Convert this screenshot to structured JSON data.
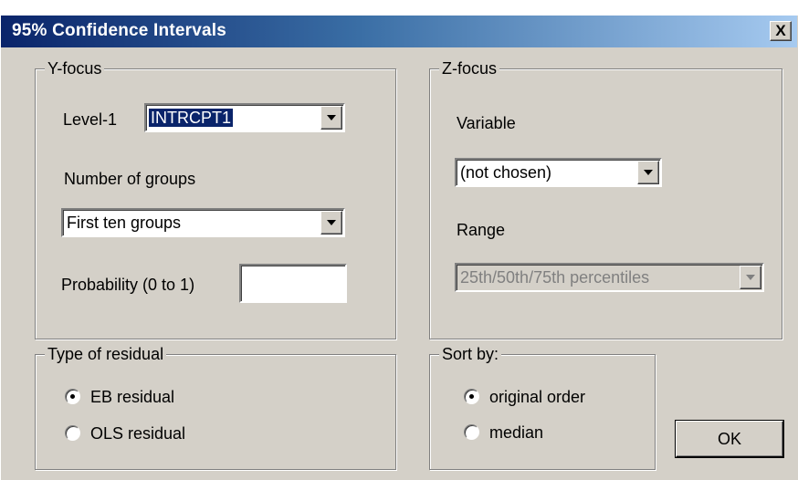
{
  "window": {
    "title": "95% Confidence Intervals",
    "close_label": "X"
  },
  "y_focus": {
    "legend": "Y-focus",
    "level1_label": "Level-1",
    "level1_value": "INTRCPT1",
    "groups_label": "Number of groups",
    "groups_value": "First ten groups",
    "probability_label": "Probability (0 to 1)",
    "probability_value": ""
  },
  "z_focus": {
    "legend": "Z-focus",
    "variable_label": "Variable",
    "variable_value": "(not chosen)",
    "range_label": "Range",
    "range_value": "25th/50th/75th percentiles"
  },
  "residual": {
    "legend": "Type of residual",
    "options": [
      {
        "label": "EB residual",
        "checked": true
      },
      {
        "label": "OLS residual",
        "checked": false
      }
    ]
  },
  "sort_by": {
    "legend": "Sort by:",
    "options": [
      {
        "label": "original order",
        "checked": true
      },
      {
        "label": "median",
        "checked": false
      }
    ]
  },
  "ok_button": "OK"
}
